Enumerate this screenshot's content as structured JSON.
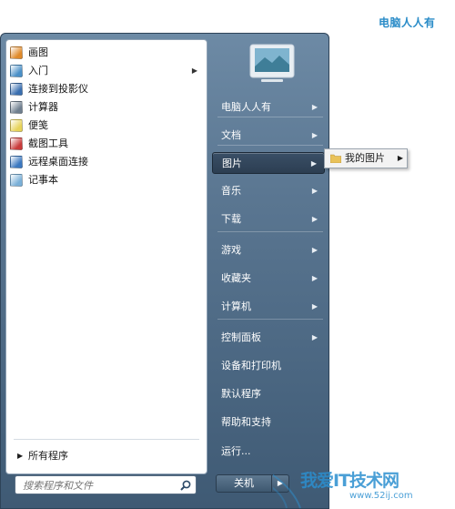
{
  "corner_caption": "电脑人人有",
  "left_pane": {
    "programs": [
      {
        "label": "画图",
        "icon": "paint-icon",
        "color": "#e08a2a",
        "has_arrow": false
      },
      {
        "label": "入门",
        "icon": "getting-started-icon",
        "color": "#4a90c8",
        "has_arrow": true
      },
      {
        "label": "连接到投影仪",
        "icon": "projector-icon",
        "color": "#3a6fb0",
        "has_arrow": false
      },
      {
        "label": "计算器",
        "icon": "calculator-icon",
        "color": "#6f7f8f",
        "has_arrow": false
      },
      {
        "label": "便笺",
        "icon": "sticky-notes-icon",
        "color": "#e7d35a",
        "has_arrow": false
      },
      {
        "label": "截图工具",
        "icon": "snipping-tool-icon",
        "color": "#c93b3b",
        "has_arrow": false
      },
      {
        "label": "远程桌面连接",
        "icon": "remote-desktop-icon",
        "color": "#3b78c0",
        "has_arrow": false
      },
      {
        "label": "记事本",
        "icon": "notepad-icon",
        "color": "#7ab0d8",
        "has_arrow": false
      }
    ],
    "all_programs": "所有程序",
    "search_placeholder": "搜索程序和文件"
  },
  "right_pane": {
    "items": [
      {
        "label": "电脑人人有",
        "has_arrow": true,
        "active": false
      },
      {
        "label": "文档",
        "has_arrow": true,
        "active": false
      },
      {
        "label": "图片",
        "has_arrow": true,
        "active": true
      },
      {
        "label": "音乐",
        "has_arrow": true,
        "active": false
      },
      {
        "label": "下载",
        "has_arrow": true,
        "active": false
      },
      {
        "label": "游戏",
        "has_arrow": true,
        "active": false
      },
      {
        "label": "收藏夹",
        "has_arrow": true,
        "active": false
      },
      {
        "label": "计算机",
        "has_arrow": true,
        "active": false
      },
      {
        "label": "控制面板",
        "has_arrow": true,
        "active": false
      },
      {
        "label": "设备和打印机",
        "has_arrow": false,
        "active": false
      },
      {
        "label": "默认程序",
        "has_arrow": false,
        "active": false
      },
      {
        "label": "帮助和支持",
        "has_arrow": false,
        "active": false
      },
      {
        "label": "运行...",
        "has_arrow": false,
        "active": false
      }
    ],
    "shutdown_label": "关机"
  },
  "submenu": {
    "label": "我的图片"
  },
  "watermark": {
    "text": "我爱IT技术网",
    "sub": "www.52ij.com"
  },
  "colors": {
    "accent": "#2a8cc8",
    "menu_blue": "#5a7691",
    "active_item": "#2c3e52"
  }
}
